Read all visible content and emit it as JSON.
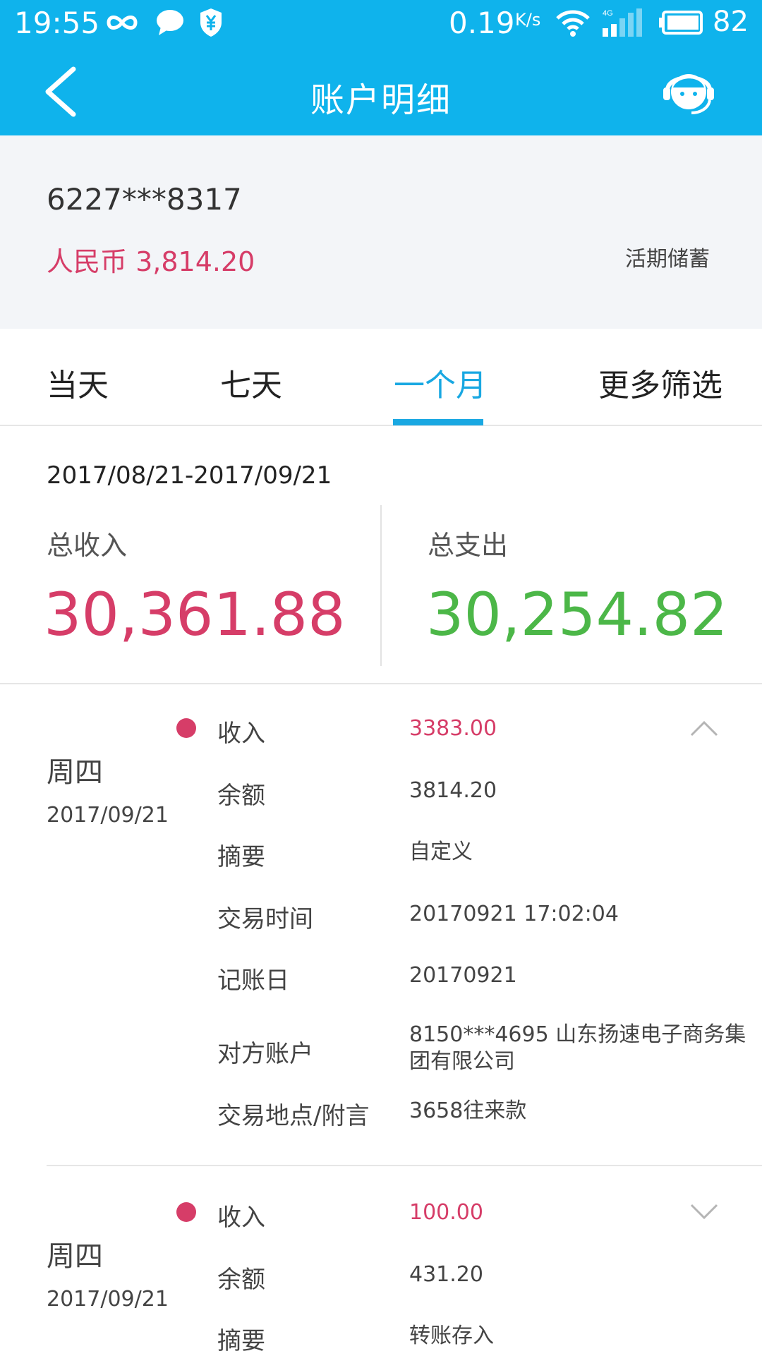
{
  "status_bar": {
    "time": "19:55",
    "net_speed": "0.19",
    "net_speed_unit": "K/s",
    "battery": "82"
  },
  "header": {
    "title": "账户明细"
  },
  "account": {
    "number": "6227***8317",
    "balance": "人民币 3,814.20",
    "type": "活期储蓄"
  },
  "tabs": [
    {
      "label": "当天"
    },
    {
      "label": "七天"
    },
    {
      "label": "一个月",
      "active": true
    },
    {
      "label": "更多筛选"
    }
  ],
  "summary": {
    "date_range": "2017/08/21-2017/09/21",
    "income_label": "总收入",
    "income_value": "30,361.88",
    "expense_label": "总支出",
    "expense_value": "30,254.82"
  },
  "transactions": [
    {
      "weekday": "周四",
      "date": "2017/09/21",
      "expanded": true,
      "rows": [
        {
          "label": "收入",
          "value": "3383.00"
        },
        {
          "label": "余额",
          "value": "3814.20"
        },
        {
          "label": "摘要",
          "value": "自定义"
        },
        {
          "label": "交易时间",
          "value": "20170921 17:02:04"
        },
        {
          "label": "记账日",
          "value": "20170921"
        },
        {
          "label": "对方账户",
          "value": "8150***4695 山东扬速电子商务集团有限公司"
        },
        {
          "label": "交易地点/附言",
          "value": "3658往来款"
        }
      ]
    },
    {
      "weekday": "周四",
      "date": "2017/09/21",
      "expanded": false,
      "rows": [
        {
          "label": "收入",
          "value": "100.00"
        },
        {
          "label": "余额",
          "value": "431.20"
        },
        {
          "label": "摘要",
          "value": "转账存入"
        }
      ]
    }
  ],
  "colors": {
    "header_bg": "#0fb3ec",
    "accent_blue": "#19a8e2",
    "income_red": "#d63d68",
    "expense_green": "#4cb748"
  },
  "icons": {
    "back": "back-arrow-icon",
    "service": "customer-service-icon",
    "collapse": "chevron-up-icon",
    "expand": "chevron-down-icon"
  }
}
